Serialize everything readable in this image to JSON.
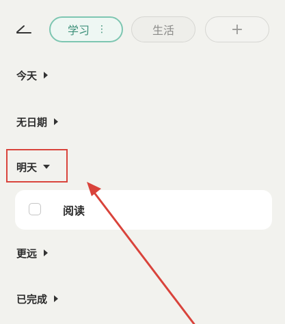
{
  "header": {
    "back_icon": "back-icon",
    "tabs": [
      {
        "label": "学习",
        "more_icon": "⋮",
        "active": true
      },
      {
        "label": "生活",
        "active": false
      }
    ],
    "add_tab_label": "+"
  },
  "sections": {
    "today": {
      "label": "今天",
      "expanded": false
    },
    "no_date": {
      "label": "无日期",
      "expanded": false
    },
    "tomorrow": {
      "label": "明天",
      "expanded": true
    },
    "later": {
      "label": "更远",
      "expanded": false
    },
    "completed": {
      "label": "已完成",
      "expanded": false
    }
  },
  "tasks": [
    {
      "label": "阅读",
      "checked": false
    }
  ],
  "colors": {
    "accent": "#7dc6b1",
    "background": "#f2f2ee",
    "annotation": "#d9433b"
  }
}
